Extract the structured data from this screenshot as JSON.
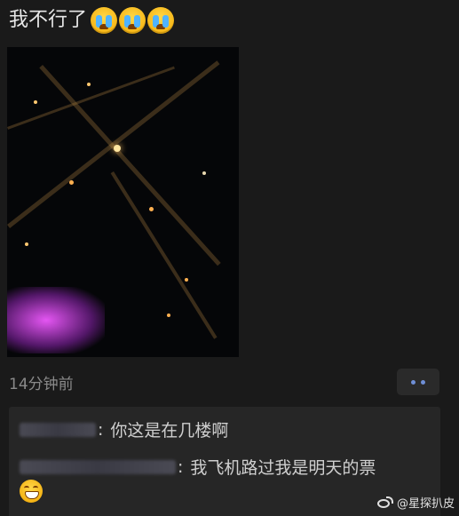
{
  "post": {
    "text": "我不行了",
    "emojis": [
      "loudly-crying-face",
      "loudly-crying-face",
      "loudly-crying-face"
    ]
  },
  "photo": {
    "description_icon": "night-aerial-city-photo"
  },
  "meta": {
    "time": "14分钟前"
  },
  "comments": [
    {
      "name": "",
      "separator": ":",
      "text": "你这是在几楼啊"
    },
    {
      "name": "",
      "separator": ":",
      "text": "我飞机路过我是明天的票",
      "trailing_emoji": "grinning-face"
    }
  ],
  "watermark": {
    "text": "@星探扒皮"
  },
  "colors": {
    "background": "#1a1a1a",
    "comment_bg": "#262626",
    "link_dots": "#6f8fd6",
    "muted": "#8a8a8a"
  }
}
